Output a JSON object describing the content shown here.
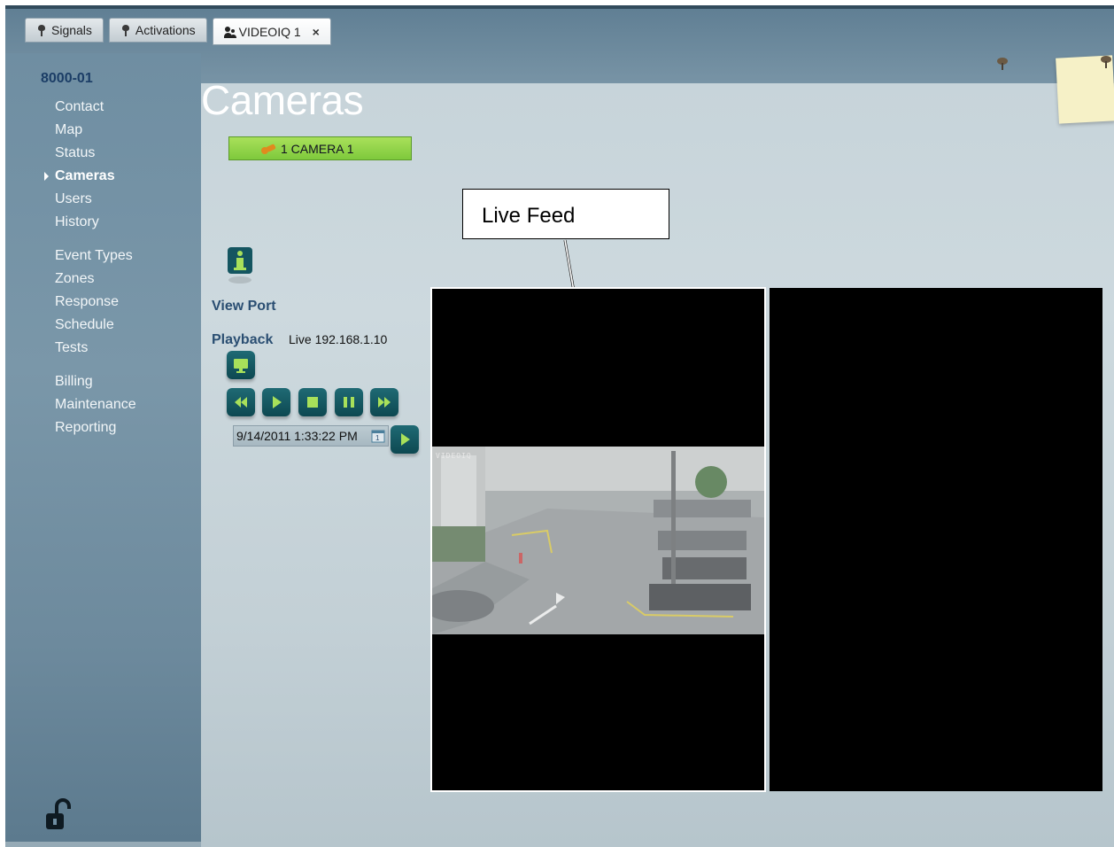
{
  "tabs": [
    {
      "label": "Signals",
      "icon": "pin-icon"
    },
    {
      "label": "Activations",
      "icon": "pin-icon"
    },
    {
      "label": "VIDEOIQ 1",
      "icon": "users-icon",
      "active": true,
      "close_icon": "close-icon"
    }
  ],
  "sidebar": {
    "account": "8000-01",
    "items": [
      "Contact",
      "Map",
      "Status",
      "Cameras",
      "Users",
      "History",
      "Event Types",
      "Zones",
      "Response",
      "Schedule",
      "Tests",
      "Billing",
      "Maintenance",
      "Reporting"
    ],
    "selected": "Cameras",
    "lock_icon": "unlock-icon"
  },
  "main": {
    "title": "Cameras",
    "camera_item": "1 CAMERA 1",
    "info_icon": "info-icon",
    "view_port_label": "View Port",
    "playback_label": "Playback",
    "playback_status": "Live 192.168.1.10",
    "datetime": "9/14/2011 1:33:22 PM",
    "controls": [
      "monitor-icon",
      "rewind-icon",
      "play-icon",
      "stop-icon",
      "pause-icon",
      "fast-forward-icon"
    ],
    "go_icon": "play-icon",
    "feed_osd": "VIDEOIQ",
    "callout": "Live Feed"
  },
  "colors": {
    "accent_green": "#7ec93c",
    "button_teal": "#0d4851",
    "label_blue": "#2a4e72"
  }
}
